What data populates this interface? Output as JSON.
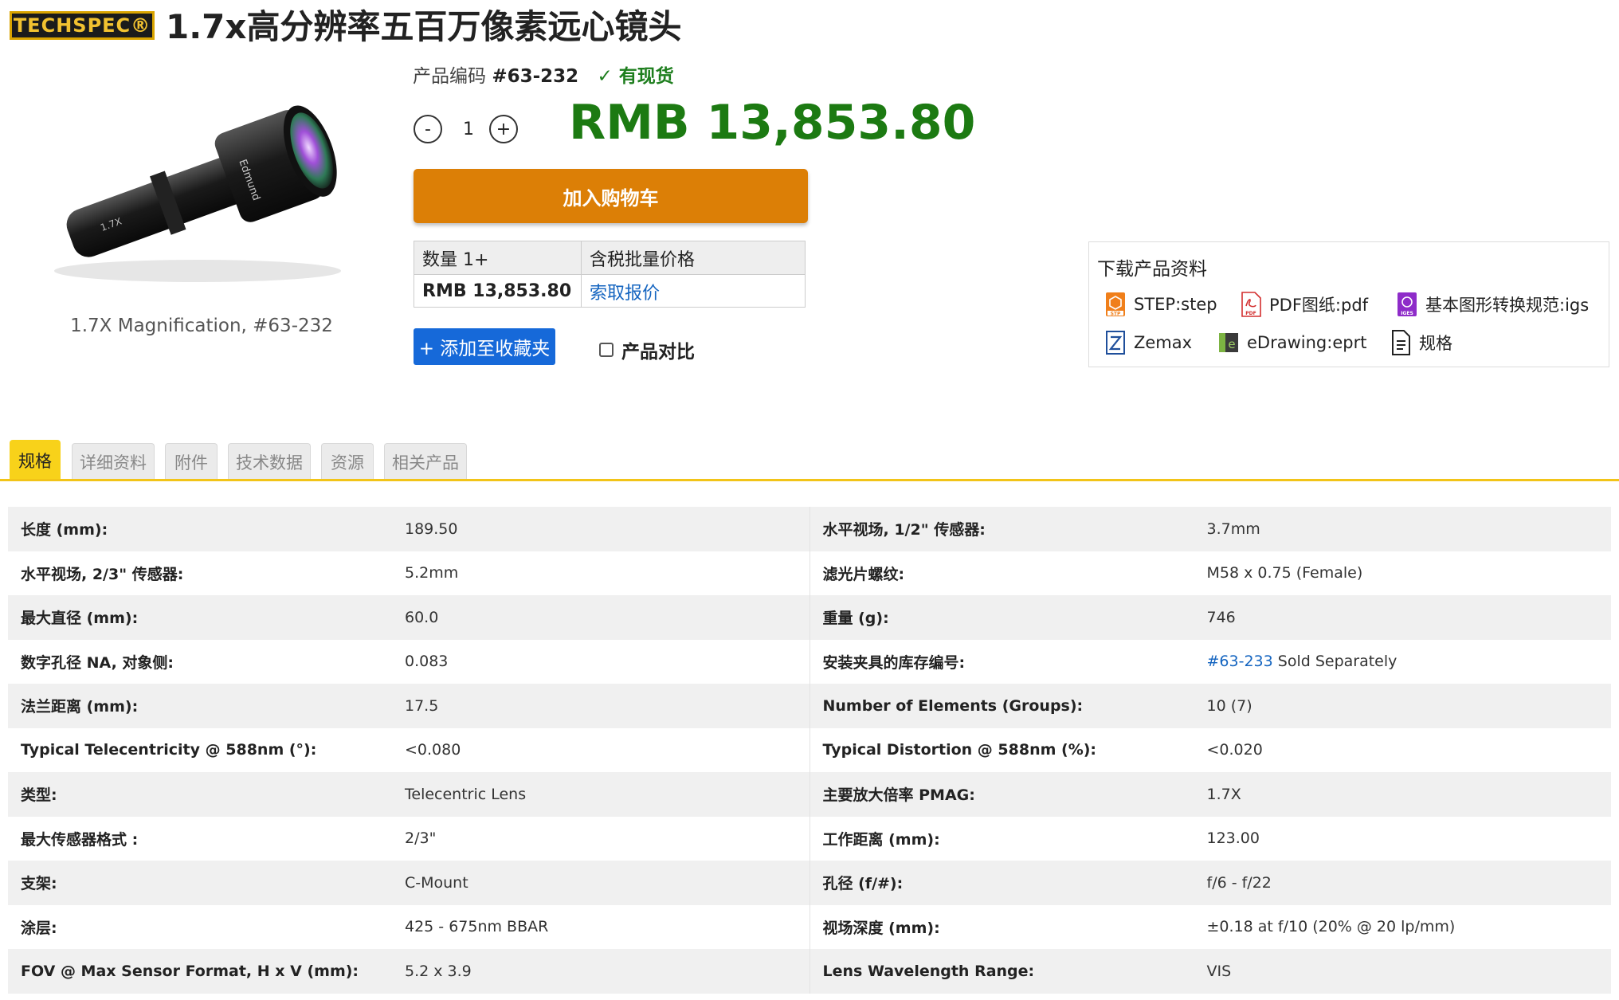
{
  "brand": {
    "logo_text": "TECHSPEC®"
  },
  "title": "1.7x高分辨率五百万像素远心镜头",
  "product_image": {
    "caption": "1.7X Magnification, #63-232",
    "lens_print": "1.7X",
    "lens_brand_print": "Edmund"
  },
  "product_code": {
    "label": "产品编码",
    "value": "#63-232",
    "stock": "有现货"
  },
  "quantity": {
    "decrement": "-",
    "value": "1",
    "increment": "+"
  },
  "price": "RMB 13,853.80",
  "cart_button": "加入购物车",
  "price_table": {
    "headers": [
      "数量 1+",
      "含税批量价格"
    ],
    "row": [
      "RMB 13,853.80",
      "索取报价"
    ]
  },
  "favorite_button": "+ 添加至收藏夹",
  "compare_label": "产品对比",
  "downloads": {
    "title": "下载产品资料",
    "items": [
      {
        "label": "STEP:step",
        "icon": "step-file-icon"
      },
      {
        "label": "PDF图纸:pdf",
        "icon": "pdf-file-icon"
      },
      {
        "label": "基本图形转换规范:igs",
        "icon": "iges-file-icon"
      },
      {
        "label": "Zemax",
        "icon": "zemax-icon"
      },
      {
        "label": "eDrawing:eprt",
        "icon": "edrawing-icon"
      },
      {
        "label": "规格",
        "icon": "document-icon"
      }
    ]
  },
  "tabs": [
    "规格",
    "详细资料",
    "附件",
    "技术数据",
    "资源",
    "相关产品"
  ],
  "active_tab": "规格",
  "specs": [
    {
      "l_label": "长度 (mm):",
      "l_value": "189.50",
      "r_label": "水平视场, 1/2\" 传感器:",
      "r_value": "3.7mm"
    },
    {
      "l_label": "水平视场, 2/3\" 传感器:",
      "l_value": "5.2mm",
      "r_label": "滤光片螺纹:",
      "r_value": "M58 x 0.75 (Female)"
    },
    {
      "l_label": "最大直径 (mm):",
      "l_value": "60.0",
      "r_label": "重量 (g):",
      "r_value": "746"
    },
    {
      "l_label": "数字孔径 NA, 对象侧:",
      "l_value": "0.083",
      "r_label": "安装夹具的库存编号:",
      "r_value_link": "#63-233",
      "r_value_suffix": " Sold Separately"
    },
    {
      "l_label": "法兰距离 (mm):",
      "l_value": "17.5",
      "r_label": "Number of Elements (Groups):",
      "r_value": "10 (7)"
    },
    {
      "l_label": "Typical Telecentricity @ 588nm (°):",
      "l_value": "<0.080",
      "r_label": "Typical Distortion @ 588nm (%):",
      "r_value": "<0.020"
    },
    {
      "l_label": "类型:",
      "l_value": "Telecentric Lens",
      "r_label": "主要放大倍率 PMAG:",
      "r_value": "1.7X"
    },
    {
      "l_label": "最大传感器格式 :",
      "l_value": "2/3\"",
      "r_label": "工作距离 (mm):",
      "r_value": "123.00"
    },
    {
      "l_label": "支架:",
      "l_value": "C-Mount",
      "r_label": "孔径 (f/#):",
      "r_value": "f/6 - f/22"
    },
    {
      "l_label": "涂层:",
      "l_value": "425 - 675nm BBAR",
      "r_label": "视场深度 (mm):",
      "r_value": "±0.18 at f/10 (20% @ 20 lp/mm)"
    },
    {
      "l_label": "FOV @ Max Sensor Format, H x V (mm):",
      "l_value": "5.2 x 3.9",
      "r_label": "Lens Wavelength Range:",
      "r_value": "VIS"
    }
  ],
  "colors": {
    "price_green": "#1c7a12",
    "cart_orange": "#dc7f06",
    "favorite_blue": "#1669d9",
    "tab_active": "#f8d21a",
    "link_blue": "#1565c0"
  }
}
